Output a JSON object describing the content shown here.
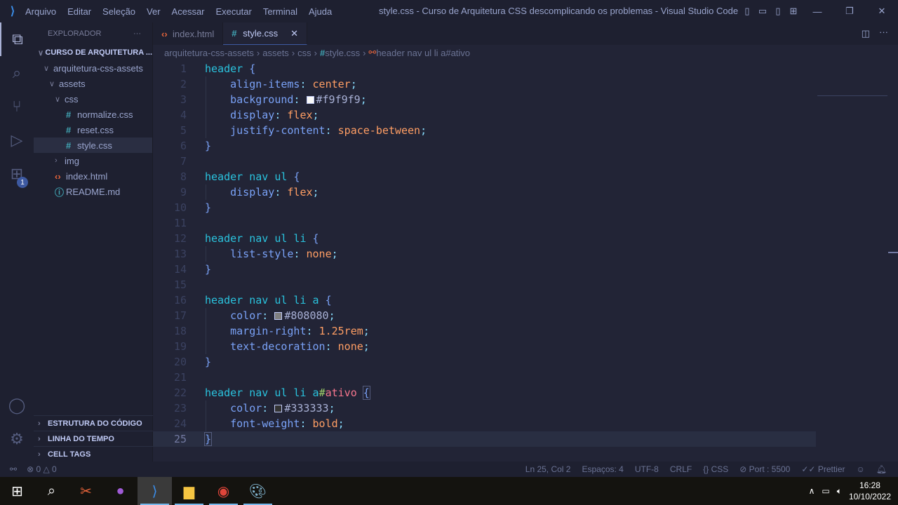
{
  "titlebar": {
    "menu": [
      "Arquivo",
      "Editar",
      "Seleção",
      "Ver",
      "Acessar",
      "Executar",
      "Terminal",
      "Ajuda"
    ],
    "title": "style.css - Curso de Arquitetura CSS descomplicando os problemas - Visual Studio Code"
  },
  "activity_bar": {
    "extensions_badge": "1"
  },
  "sidebar": {
    "header": "EXPLORADOR",
    "more": "···",
    "tree": [
      {
        "label": "CURSO DE ARQUITETURA ...",
        "depth": 0,
        "kind": "root",
        "chev": "∨"
      },
      {
        "label": "arquitetura-css-assets",
        "depth": 1,
        "kind": "folder",
        "chev": "∨"
      },
      {
        "label": "assets",
        "depth": 2,
        "kind": "folder",
        "chev": "∨"
      },
      {
        "label": "css",
        "depth": 3,
        "kind": "folder",
        "chev": "∨"
      },
      {
        "label": "normalize.css",
        "depth": 4,
        "kind": "css"
      },
      {
        "label": "reset.css",
        "depth": 4,
        "kind": "css"
      },
      {
        "label": "style.css",
        "depth": 4,
        "kind": "css",
        "selected": true
      },
      {
        "label": "img",
        "depth": 3,
        "kind": "folder",
        "chev": "›"
      },
      {
        "label": "index.html",
        "depth": 2,
        "kind": "html"
      },
      {
        "label": "README.md",
        "depth": 2,
        "kind": "info"
      }
    ],
    "panels": [
      "ESTRUTURA DO CÓDIGO",
      "LINHA DO TEMPO",
      "CELL TAGS"
    ]
  },
  "tabs": [
    {
      "label": "index.html",
      "icon": "html"
    },
    {
      "label": "style.css",
      "icon": "css",
      "active": true,
      "close": "✕"
    }
  ],
  "breadcrumb": [
    "arquitetura-css-assets",
    "assets",
    "css",
    "style.css",
    "header nav ul li a#ativo"
  ],
  "editor": {
    "current_line": 25,
    "lines": [
      [
        [
          "sel",
          "header"
        ],
        [
          "plain",
          " "
        ],
        [
          "brace",
          "{"
        ]
      ],
      [
        [
          "plain",
          "    "
        ],
        [
          "prop",
          "align-items"
        ],
        [
          "punc",
          ": "
        ],
        [
          "val",
          "center"
        ],
        [
          "punc",
          ";"
        ]
      ],
      [
        [
          "plain",
          "    "
        ],
        [
          "prop",
          "background"
        ],
        [
          "punc",
          ": "
        ],
        [
          "swatch",
          "#f9f9f9"
        ],
        [
          "plain",
          "#f9f9f9"
        ],
        [
          "punc",
          ";"
        ]
      ],
      [
        [
          "plain",
          "    "
        ],
        [
          "prop",
          "display"
        ],
        [
          "punc",
          ": "
        ],
        [
          "val",
          "flex"
        ],
        [
          "punc",
          ";"
        ]
      ],
      [
        [
          "plain",
          "    "
        ],
        [
          "prop",
          "justify-content"
        ],
        [
          "punc",
          ": "
        ],
        [
          "val",
          "space-between"
        ],
        [
          "punc",
          ";"
        ]
      ],
      [
        [
          "brace",
          "}"
        ]
      ],
      [],
      [
        [
          "sel",
          "header nav ul"
        ],
        [
          "plain",
          " "
        ],
        [
          "brace",
          "{"
        ]
      ],
      [
        [
          "plain",
          "    "
        ],
        [
          "prop",
          "display"
        ],
        [
          "punc",
          ": "
        ],
        [
          "val",
          "flex"
        ],
        [
          "punc",
          ";"
        ]
      ],
      [
        [
          "brace",
          "}"
        ]
      ],
      [],
      [
        [
          "sel",
          "header nav ul li"
        ],
        [
          "plain",
          " "
        ],
        [
          "brace",
          "{"
        ]
      ],
      [
        [
          "plain",
          "    "
        ],
        [
          "prop",
          "list-style"
        ],
        [
          "punc",
          ": "
        ],
        [
          "val",
          "none"
        ],
        [
          "punc",
          ";"
        ]
      ],
      [
        [
          "brace",
          "}"
        ]
      ],
      [],
      [
        [
          "sel",
          "header nav ul li a"
        ],
        [
          "plain",
          " "
        ],
        [
          "brace",
          "{"
        ]
      ],
      [
        [
          "plain",
          "    "
        ],
        [
          "prop",
          "color"
        ],
        [
          "punc",
          ": "
        ],
        [
          "swatch",
          "#808080"
        ],
        [
          "plain",
          "#808080"
        ],
        [
          "punc",
          ";"
        ]
      ],
      [
        [
          "plain",
          "    "
        ],
        [
          "prop",
          "margin-right"
        ],
        [
          "punc",
          ": "
        ],
        [
          "val",
          "1.25rem"
        ],
        [
          "punc",
          ";"
        ]
      ],
      [
        [
          "plain",
          "    "
        ],
        [
          "prop",
          "text-decoration"
        ],
        [
          "punc",
          ": "
        ],
        [
          "val",
          "none"
        ],
        [
          "punc",
          ";"
        ]
      ],
      [
        [
          "brace",
          "}"
        ]
      ],
      [],
      [
        [
          "sel",
          "header nav ul li a"
        ],
        [
          "hash",
          "#"
        ],
        [
          "id",
          "ativo"
        ],
        [
          "plain",
          " "
        ],
        [
          "bracket",
          "{"
        ]
      ],
      [
        [
          "plain",
          "    "
        ],
        [
          "prop",
          "color"
        ],
        [
          "punc",
          ": "
        ],
        [
          "swatch",
          "#333333"
        ],
        [
          "plain",
          "#333333"
        ],
        [
          "punc",
          ";"
        ]
      ],
      [
        [
          "plain",
          "    "
        ],
        [
          "prop",
          "font-weight"
        ],
        [
          "punc",
          ": "
        ],
        [
          "val",
          "bold"
        ],
        [
          "punc",
          ";"
        ]
      ],
      [
        [
          "bracket",
          "}"
        ]
      ]
    ]
  },
  "status": {
    "errors": "0",
    "warnings": "0",
    "position": "Ln 25, Col 2",
    "spaces": "Espaços: 4",
    "encoding": "UTF-8",
    "eol": "CRLF",
    "language": "CSS",
    "port": "Port : 5500",
    "prettier": "Prettier"
  },
  "taskbar": {
    "time": "16:28",
    "date": "10/10/2022"
  }
}
